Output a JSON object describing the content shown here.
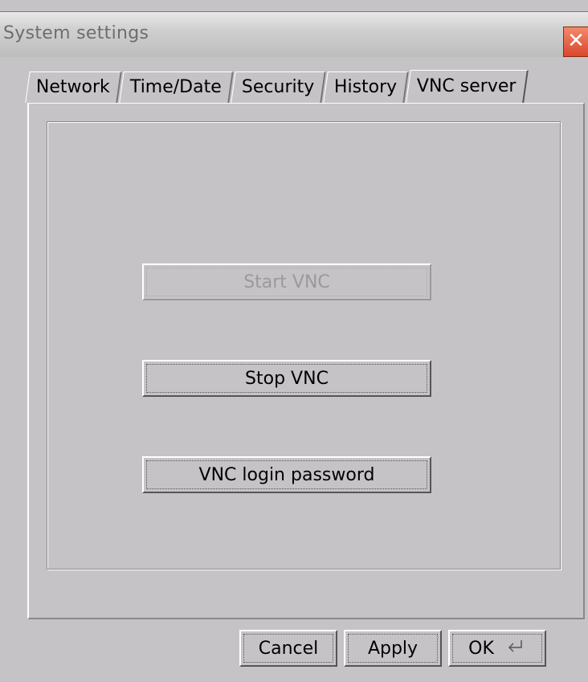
{
  "window": {
    "title": "System settings",
    "close_glyph": "✕"
  },
  "tabs": [
    {
      "label": "Network"
    },
    {
      "label": "Time/Date"
    },
    {
      "label": "Security"
    },
    {
      "label": "History"
    },
    {
      "label": "VNC server",
      "active": true
    }
  ],
  "vnc": {
    "start_label": "Start VNC",
    "start_enabled": false,
    "stop_label": "Stop VNC",
    "password_label": "VNC login password"
  },
  "footer": {
    "cancel_label": "Cancel",
    "apply_label": "Apply",
    "ok_label": "OK",
    "ok_icon": "enter-key-icon"
  }
}
